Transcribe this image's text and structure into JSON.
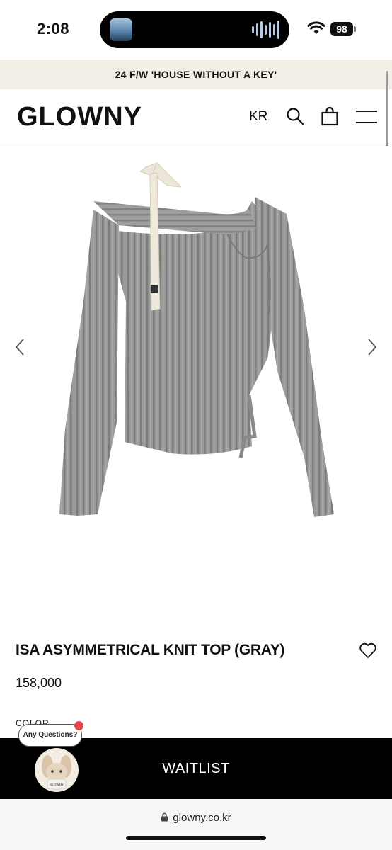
{
  "status_bar": {
    "time": "2:08",
    "battery": "98",
    "icons": [
      "wifi-icon",
      "battery-icon"
    ]
  },
  "announcement": {
    "text": "24 F/W 'HOUSE WITHOUT A KEY'"
  },
  "header": {
    "logo": "GLOWNY",
    "language": "KR",
    "icons": [
      "search-icon",
      "shopping-bag-icon",
      "menu-icon"
    ]
  },
  "gallery": {
    "image_alt": "gray asymmetrical ribbed knit top with cream ribbon",
    "icons": [
      "chevron-left-icon",
      "chevron-right-icon"
    ]
  },
  "product": {
    "title": "ISA ASYMMETRICAL KNIT TOP (GRAY)",
    "price": "158,000",
    "color_label": "COLOR",
    "wishlist_icon": "heart-icon"
  },
  "chat": {
    "bubble_text": "Any Questions?",
    "avatar_label": "GLOWNY"
  },
  "cta": {
    "label": "WAITLIST"
  },
  "url_bar": {
    "url": "glowny.co.kr",
    "icon": "lock-icon"
  },
  "colors": {
    "announcement_bg": "#f2eee6",
    "cta_bg": "#000000",
    "product_gray": "#9a9a9a"
  }
}
